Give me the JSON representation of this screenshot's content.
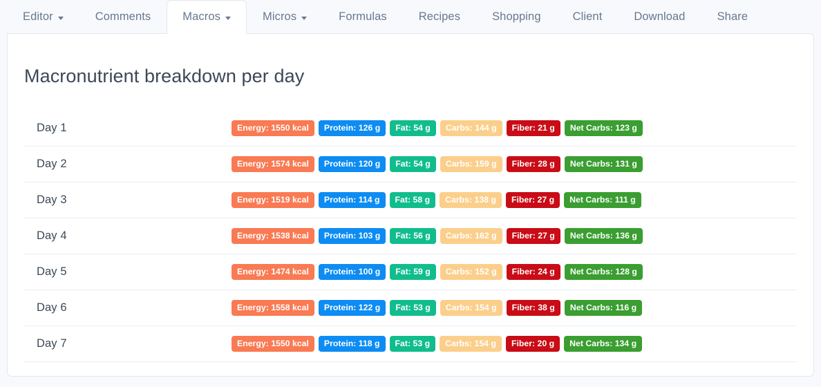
{
  "tabs": [
    {
      "label": "Editor",
      "caret": true,
      "active": false,
      "icon": "chevron-down-icon"
    },
    {
      "label": "Comments",
      "caret": false,
      "active": false
    },
    {
      "label": "Macros",
      "caret": true,
      "active": true,
      "icon": "chevron-down-icon"
    },
    {
      "label": "Micros",
      "caret": true,
      "active": false,
      "icon": "chevron-down-icon"
    },
    {
      "label": "Formulas",
      "caret": false,
      "active": false
    },
    {
      "label": "Recipes",
      "caret": false,
      "active": false
    },
    {
      "label": "Shopping",
      "caret": false,
      "active": false
    },
    {
      "label": "Client",
      "caret": false,
      "active": false
    },
    {
      "label": "Download",
      "caret": false,
      "active": false
    },
    {
      "label": "Share",
      "caret": false,
      "active": false
    }
  ],
  "main": {
    "title": "Macronutrient breakdown per day"
  },
  "colors": {
    "page_background": "#f8f9fc",
    "panel_background": "#ffffff",
    "panel_border": "#e3e6ef",
    "row_separator": "#eceef3",
    "text_primary": "#3c4858",
    "text_muted": "#67788f",
    "energy": "#f97a53",
    "protein": "#0d8cf3",
    "fat": "#11bd8d",
    "carbs": "#fbcf8b",
    "fiber": "#c90c16",
    "net_carbs": "#3a9e31"
  },
  "badge_types": [
    {
      "key": "energy",
      "prefix": "Energy",
      "unit": "kcal",
      "color": "#f97a53"
    },
    {
      "key": "protein",
      "prefix": "Protein",
      "unit": "g",
      "color": "#0d8cf3"
    },
    {
      "key": "fat",
      "prefix": "Fat",
      "unit": "g",
      "color": "#11bd8d"
    },
    {
      "key": "carbs",
      "prefix": "Carbs",
      "unit": "g",
      "color": "#fbcf8b"
    },
    {
      "key": "fiber",
      "prefix": "Fiber",
      "unit": "g",
      "color": "#c90c16"
    },
    {
      "key": "net_carbs",
      "prefix": "Net Carbs",
      "unit": "g",
      "color": "#3a9e31"
    }
  ],
  "rows": [
    {
      "label": "Day 1",
      "badges": [
        {
          "name": "energy-badge",
          "text": "Energy: 1550 kcal",
          "color": "#f97a53"
        },
        {
          "name": "protein-badge",
          "text": "Protein: 126 g",
          "color": "#0d8cf3"
        },
        {
          "name": "fat-badge",
          "text": "Fat: 54 g",
          "color": "#11bd8d"
        },
        {
          "name": "carbs-badge",
          "text": "Carbs: 144 g",
          "color": "#fbcf8b"
        },
        {
          "name": "fiber-badge",
          "text": "Fiber: 21 g",
          "color": "#c90c16"
        },
        {
          "name": "net-carbs-badge",
          "text": "Net Carbs: 123 g",
          "color": "#3a9e31"
        }
      ]
    },
    {
      "label": "Day 2",
      "badges": [
        {
          "name": "energy-badge",
          "text": "Energy: 1574 kcal",
          "color": "#f97a53"
        },
        {
          "name": "protein-badge",
          "text": "Protein: 120 g",
          "color": "#0d8cf3"
        },
        {
          "name": "fat-badge",
          "text": "Fat: 54 g",
          "color": "#11bd8d"
        },
        {
          "name": "carbs-badge",
          "text": "Carbs: 159 g",
          "color": "#fbcf8b"
        },
        {
          "name": "fiber-badge",
          "text": "Fiber: 28 g",
          "color": "#c90c16"
        },
        {
          "name": "net-carbs-badge",
          "text": "Net Carbs: 131 g",
          "color": "#3a9e31"
        }
      ]
    },
    {
      "label": "Day 3",
      "badges": [
        {
          "name": "energy-badge",
          "text": "Energy: 1519 kcal",
          "color": "#f97a53"
        },
        {
          "name": "protein-badge",
          "text": "Protein: 114 g",
          "color": "#0d8cf3"
        },
        {
          "name": "fat-badge",
          "text": "Fat: 58 g",
          "color": "#11bd8d"
        },
        {
          "name": "carbs-badge",
          "text": "Carbs: 138 g",
          "color": "#fbcf8b"
        },
        {
          "name": "fiber-badge",
          "text": "Fiber: 27 g",
          "color": "#c90c16"
        },
        {
          "name": "net-carbs-badge",
          "text": "Net Carbs: 111 g",
          "color": "#3a9e31"
        }
      ]
    },
    {
      "label": "Day 4",
      "badges": [
        {
          "name": "energy-badge",
          "text": "Energy: 1538 kcal",
          "color": "#f97a53"
        },
        {
          "name": "protein-badge",
          "text": "Protein: 103 g",
          "color": "#0d8cf3"
        },
        {
          "name": "fat-badge",
          "text": "Fat: 56 g",
          "color": "#11bd8d"
        },
        {
          "name": "carbs-badge",
          "text": "Carbs: 162 g",
          "color": "#fbcf8b"
        },
        {
          "name": "fiber-badge",
          "text": "Fiber: 27 g",
          "color": "#c90c16"
        },
        {
          "name": "net-carbs-badge",
          "text": "Net Carbs: 136 g",
          "color": "#3a9e31"
        }
      ]
    },
    {
      "label": "Day 5",
      "badges": [
        {
          "name": "energy-badge",
          "text": "Energy: 1474 kcal",
          "color": "#f97a53"
        },
        {
          "name": "protein-badge",
          "text": "Protein: 100 g",
          "color": "#0d8cf3"
        },
        {
          "name": "fat-badge",
          "text": "Fat: 59 g",
          "color": "#11bd8d"
        },
        {
          "name": "carbs-badge",
          "text": "Carbs: 152 g",
          "color": "#fbcf8b"
        },
        {
          "name": "fiber-badge",
          "text": "Fiber: 24 g",
          "color": "#c90c16"
        },
        {
          "name": "net-carbs-badge",
          "text": "Net Carbs: 128 g",
          "color": "#3a9e31"
        }
      ]
    },
    {
      "label": "Day 6",
      "badges": [
        {
          "name": "energy-badge",
          "text": "Energy: 1558 kcal",
          "color": "#f97a53"
        },
        {
          "name": "protein-badge",
          "text": "Protein: 122 g",
          "color": "#0d8cf3"
        },
        {
          "name": "fat-badge",
          "text": "Fat: 53 g",
          "color": "#11bd8d"
        },
        {
          "name": "carbs-badge",
          "text": "Carbs: 154 g",
          "color": "#fbcf8b"
        },
        {
          "name": "fiber-badge",
          "text": "Fiber: 38 g",
          "color": "#c90c16"
        },
        {
          "name": "net-carbs-badge",
          "text": "Net Carbs: 116 g",
          "color": "#3a9e31"
        }
      ]
    },
    {
      "label": "Day 7",
      "badges": [
        {
          "name": "energy-badge",
          "text": "Energy: 1550 kcal",
          "color": "#f97a53"
        },
        {
          "name": "protein-badge",
          "text": "Protein: 118 g",
          "color": "#0d8cf3"
        },
        {
          "name": "fat-badge",
          "text": "Fat: 53 g",
          "color": "#11bd8d"
        },
        {
          "name": "carbs-badge",
          "text": "Carbs: 154 g",
          "color": "#fbcf8b"
        },
        {
          "name": "fiber-badge",
          "text": "Fiber: 20 g",
          "color": "#c90c16"
        },
        {
          "name": "net-carbs-badge",
          "text": "Net Carbs: 134 g",
          "color": "#3a9e31"
        }
      ]
    }
  ]
}
